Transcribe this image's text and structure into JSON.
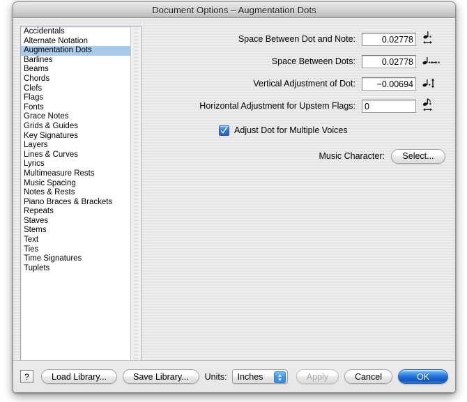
{
  "window": {
    "title": "Document Options – Augmentation Dots"
  },
  "sidebar": {
    "selected": "Augmentation Dots",
    "items": [
      "Accidentals",
      "Alternate Notation",
      "Augmentation Dots",
      "Barlines",
      "Beams",
      "Chords",
      "Clefs",
      "Flags",
      "Fonts",
      "Grace Notes",
      "Grids & Guides",
      "Key Signatures",
      "Layers",
      "Lines & Curves",
      "Lyrics",
      "Multimeasure Rests",
      "Music Spacing",
      "Notes & Rests",
      "Piano Braces & Brackets",
      "Repeats",
      "Staves",
      "Stems",
      "Text",
      "Ties",
      "Time Signatures",
      "Tuplets"
    ]
  },
  "form": {
    "fields": [
      {
        "label": "Space Between Dot and Note:",
        "value": "0.02778",
        "align": "right",
        "icon": "dotted-note-horizontal-arrow-icon"
      },
      {
        "label": "Space Between Dots:",
        "value": "0.02778",
        "align": "right",
        "icon": "note-two-dots-horizontal-arrow-icon"
      },
      {
        "label": "Vertical Adjustment of Dot:",
        "value": "−0.00694",
        "align": "right",
        "icon": "dotted-note-vertical-arrow-icon"
      },
      {
        "label": "Horizontal Adjustment for Upstem Flags:",
        "value": "0",
        "align": "left",
        "icon": "flagged-note-horizontal-arrow-icon"
      }
    ],
    "checkbox": {
      "label": "Adjust Dot for Multiple Voices",
      "checked": true
    },
    "music_character": {
      "label": "Music Character:",
      "button_label": "Select..."
    }
  },
  "bottom_bar": {
    "help_label": "?",
    "load_library_label": "Load Library...",
    "save_library_label": "Save Library...",
    "units_label": "Units:",
    "units_value": "Inches",
    "apply_label": "Apply",
    "apply_enabled": false,
    "cancel_label": "Cancel",
    "ok_label": "OK"
  },
  "colors": {
    "selection": "#a9cbeb",
    "default_button": "#1f6fd8",
    "checkbox_fill": "#2f72c8"
  }
}
